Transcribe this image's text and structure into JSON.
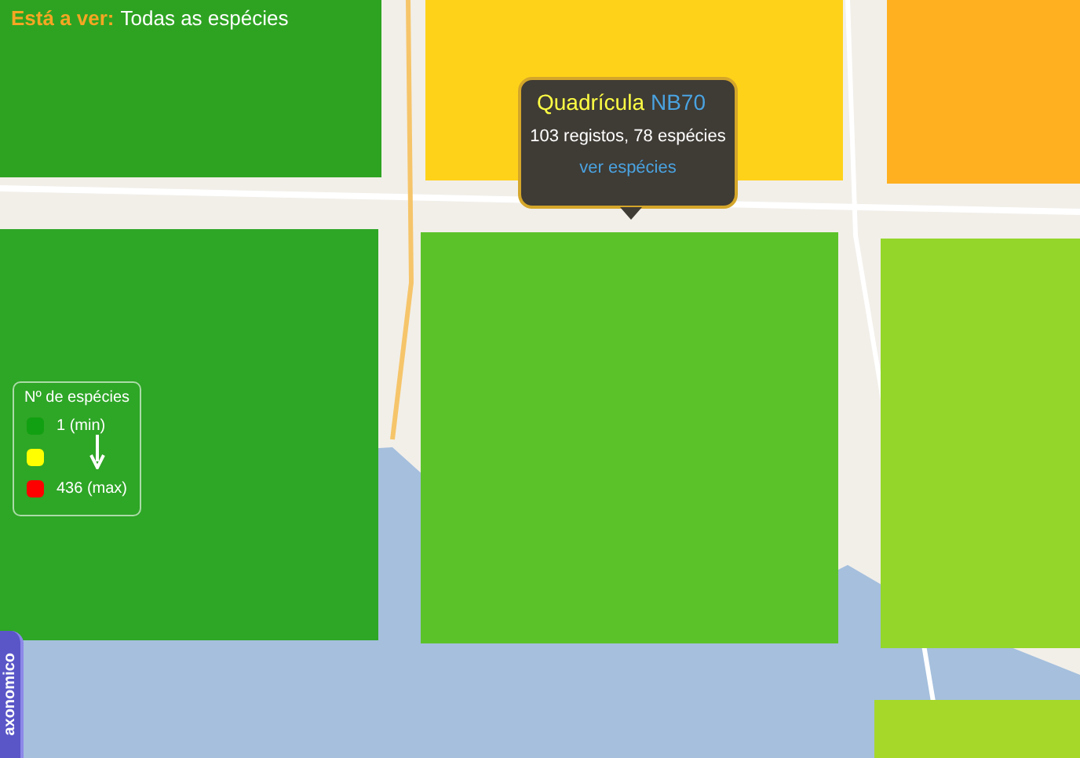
{
  "header": {
    "label": "Está a ver:",
    "value": "Todas as espécies"
  },
  "grid_cells": [
    {
      "color": "#2ea322"
    },
    {
      "color": "#ffd21a"
    },
    {
      "color": "#ffb020"
    },
    {
      "color": "#2ea626"
    },
    {
      "color": "#5cc22a"
    },
    {
      "color": "#94d62a"
    },
    {
      "color": "#a6d82a"
    }
  ],
  "popup": {
    "title": "Quadrícula",
    "code": "NB70",
    "summary": "103 registos, 78 espécies",
    "link": "ver espécies"
  },
  "legend": {
    "title": "Nº de espécies",
    "items": [
      {
        "color": "#11a011",
        "label": "1 (min)"
      },
      {
        "color": "#ffff00"
      },
      {
        "color": "#ff0000",
        "label": "436 (max)"
      }
    ]
  },
  "side_tab": {
    "label": "axonomico"
  }
}
